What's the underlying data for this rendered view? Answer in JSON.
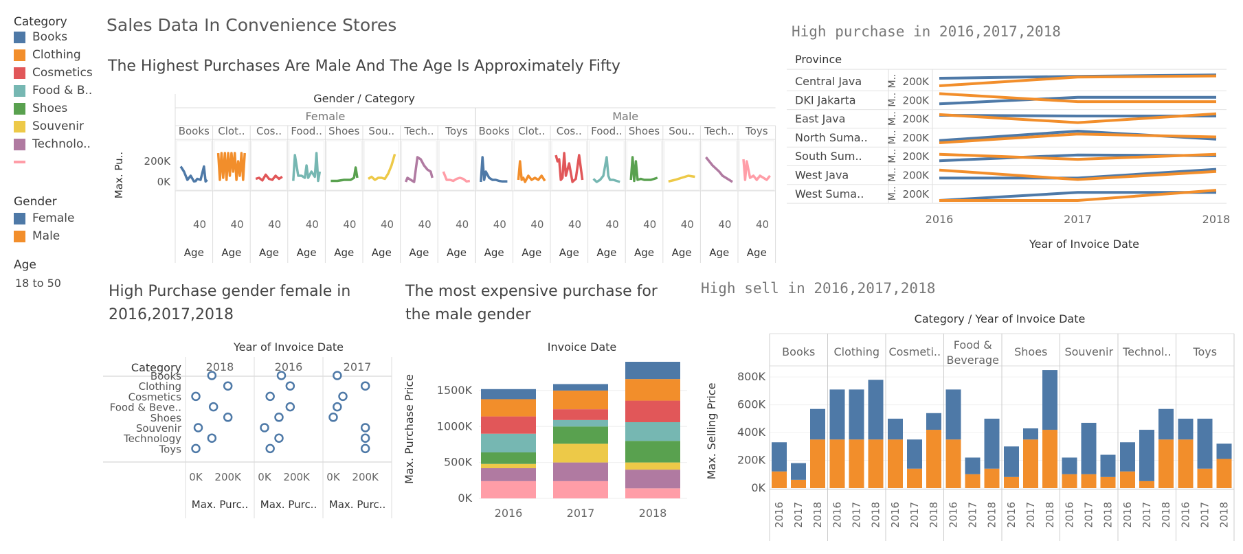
{
  "dashboard": {
    "title": "Sales Data In Convenience Stores",
    "subtitle": "The  Highest Purchases Are Male And The Age Is Approximately Fifty",
    "title_female": "High Purchase gender female in 2016,2017,2018",
    "title_male": "The most expensive purchase for the male gender",
    "title_province": "High purchase in 2016,2017,2018",
    "title_sell": "High sell in 2016,2017,2018"
  },
  "legend": {
    "category_title": "Category",
    "categories": [
      {
        "label": "Books",
        "color": "#4e79a7"
      },
      {
        "label": "Clothing",
        "color": "#f28e2b"
      },
      {
        "label": "Cosmetics",
        "color": "#e15759"
      },
      {
        "label": "Food & B..",
        "color": "#76b7b2"
      },
      {
        "label": "Shoes",
        "color": "#59a14f"
      },
      {
        "label": "Souvenir",
        "color": "#edc948"
      },
      {
        "label": "Technolo..",
        "color": "#b07aa1"
      },
      {
        "label": "",
        "color": "#ff9da7"
      }
    ],
    "gender_title": "Gender",
    "genders": [
      {
        "label": "Female",
        "color": "#4e79a7"
      },
      {
        "label": "Male",
        "color": "#f28e2b"
      }
    ],
    "age_title": "Age",
    "age_value": "18 to 50"
  },
  "chart_data": [
    {
      "id": "age-gender-category",
      "type": "line",
      "title": "Gender / Category",
      "ylabel": "Max. Pu..",
      "xlabel": "Age",
      "x_tick": "40",
      "y_ticks": [
        "200K",
        "0K"
      ],
      "ylim": [
        0,
        300000
      ],
      "genders": [
        "Female",
        "Male"
      ],
      "category_headers": [
        "Books",
        "Clot..",
        "Cos..",
        "Food..",
        "Shoes",
        "Sou..",
        "Tech..",
        "Toys"
      ],
      "category_colors": [
        "#4e79a7",
        "#f28e2b",
        "#e15759",
        "#76b7b2",
        "#59a14f",
        "#edc948",
        "#b07aa1",
        "#ff9da7"
      ],
      "series": [
        {
          "gender": "Female",
          "category": "Books",
          "x": [
            18,
            22,
            26,
            30,
            34,
            36,
            38,
            42,
            46,
            48,
            50
          ],
          "values": [
            150000,
            100000,
            20000,
            60000,
            5000,
            8000,
            30000,
            20000,
            150000,
            5000,
            20000
          ]
        },
        {
          "gender": "Female",
          "category": "Clothing",
          "x": [
            18,
            20,
            22,
            24,
            26,
            28,
            30,
            32,
            34,
            36,
            38,
            40,
            42,
            44,
            46,
            48,
            50
          ],
          "values": [
            280000,
            20000,
            280000,
            40000,
            280000,
            20000,
            280000,
            60000,
            280000,
            100000,
            280000,
            20000,
            200000,
            60000,
            280000,
            20000,
            280000
          ]
        },
        {
          "gender": "Female",
          "category": "Cosmetics",
          "x": [
            18,
            22,
            26,
            30,
            34,
            38,
            42,
            46,
            50
          ],
          "values": [
            30000,
            40000,
            15000,
            70000,
            30000,
            20000,
            60000,
            30000,
            50000
          ]
        },
        {
          "gender": "Female",
          "category": "Food & Beverage",
          "x": [
            18,
            20,
            24,
            28,
            32,
            34,
            36,
            40,
            44,
            46,
            48,
            50
          ],
          "values": [
            10000,
            260000,
            60000,
            60000,
            40000,
            160000,
            40000,
            100000,
            50000,
            280000,
            10000,
            100000
          ]
        },
        {
          "gender": "Female",
          "category": "Shoes",
          "x": [
            18,
            26,
            34,
            42,
            46,
            48,
            50
          ],
          "values": [
            10000,
            10000,
            20000,
            20000,
            40000,
            140000,
            40000
          ]
        },
        {
          "gender": "Female",
          "category": "Souvenir",
          "x": [
            18,
            22,
            26,
            30,
            34,
            38,
            42,
            46,
            50
          ],
          "values": [
            30000,
            50000,
            20000,
            40000,
            40000,
            30000,
            80000,
            160000,
            270000
          ]
        },
        {
          "gender": "Female",
          "category": "Technology",
          "x": [
            18,
            20,
            24,
            28,
            32,
            36,
            40,
            44,
            48,
            50
          ],
          "values": [
            0,
            40000,
            20000,
            0,
            240000,
            220000,
            160000,
            120000,
            100000,
            40000
          ]
        },
        {
          "gender": "Female",
          "category": "Toys",
          "x": [
            18,
            22,
            26,
            30,
            34,
            38,
            42,
            46,
            50
          ],
          "values": [
            100000,
            20000,
            20000,
            10000,
            30000,
            40000,
            30000,
            5000,
            10000
          ]
        },
        {
          "gender": "Male",
          "category": "Books",
          "x": [
            18,
            20,
            22,
            24,
            28,
            32,
            36,
            40,
            44,
            48,
            50
          ],
          "values": [
            0,
            240000,
            20000,
            100000,
            40000,
            20000,
            20000,
            10000,
            5000,
            5000,
            5000
          ]
        },
        {
          "gender": "Male",
          "category": "Clothing",
          "x": [
            18,
            20,
            22,
            24,
            26,
            30,
            34,
            38,
            42,
            46,
            50
          ],
          "values": [
            20000,
            200000,
            20000,
            40000,
            0,
            60000,
            20000,
            40000,
            20000,
            60000,
            10000
          ]
        },
        {
          "gender": "Male",
          "category": "Cosmetics",
          "x": [
            18,
            20,
            22,
            24,
            26,
            28,
            30,
            34,
            38,
            42,
            46,
            50
          ],
          "values": [
            260000,
            200000,
            220000,
            20000,
            40000,
            280000,
            60000,
            180000,
            0,
            30000,
            260000,
            20000
          ]
        },
        {
          "gender": "Male",
          "category": "Food & Beverage",
          "x": [
            18,
            22,
            26,
            30,
            32,
            34,
            36,
            38,
            42,
            46,
            50
          ],
          "values": [
            30000,
            0,
            20000,
            60000,
            150000,
            240000,
            60000,
            20000,
            20000,
            10000,
            0
          ]
        },
        {
          "gender": "Male",
          "category": "Shoes",
          "x": [
            18,
            20,
            22,
            24,
            26,
            30,
            34,
            38,
            42,
            46,
            50
          ],
          "values": [
            20000,
            240000,
            10000,
            200000,
            20000,
            30000,
            20000,
            20000,
            20000,
            30000,
            40000
          ]
        },
        {
          "gender": "Male",
          "category": "Souvenir",
          "x": [
            18,
            26,
            34,
            42,
            50
          ],
          "values": [
            5000,
            20000,
            40000,
            60000,
            50000
          ]
        },
        {
          "gender": "Male",
          "category": "Technology",
          "x": [
            18,
            22,
            26,
            30,
            34,
            38,
            42,
            46,
            50
          ],
          "values": [
            240000,
            200000,
            160000,
            130000,
            100000,
            60000,
            40000,
            20000,
            0
          ]
        },
        {
          "gender": "Male",
          "category": "Toys",
          "x": [
            18,
            20,
            22,
            26,
            30,
            34,
            38,
            42,
            46,
            50
          ],
          "values": [
            220000,
            20000,
            200000,
            40000,
            60000,
            20000,
            60000,
            40000,
            20000,
            60000
          ]
        }
      ]
    },
    {
      "id": "province-yearly",
      "type": "line",
      "title": "High purchase in 2016,2017,2018",
      "row_header": "Province",
      "provinces": [
        "Central Java",
        "DKI Jakarta",
        "East Java",
        "North Suma..",
        "South Sum..",
        "West Java",
        "West Suma.."
      ],
      "measure_label": "M..",
      "y_tick": "200K",
      "x": [
        "2016",
        "2017",
        "2018"
      ],
      "xlabel": "Year of Invoice Date",
      "series": [
        {
          "province": "Central Java",
          "gender": "Female",
          "values": [
            0.72,
            0.85,
            0.95
          ]
        },
        {
          "province": "Central Java",
          "gender": "Male",
          "values": [
            0.2,
            0.8,
            0.88
          ]
        },
        {
          "province": "DKI Jakarta",
          "gender": "Female",
          "values": [
            0.25,
            0.7,
            0.7
          ]
        },
        {
          "province": "DKI Jakarta",
          "gender": "Male",
          "values": [
            0.95,
            0.4,
            0.4
          ]
        },
        {
          "province": "East Java",
          "gender": "Female",
          "values": [
            0.75,
            0.7,
            0.7
          ]
        },
        {
          "province": "East Java",
          "gender": "Male",
          "values": [
            0.8,
            0.25,
            0.85
          ]
        },
        {
          "province": "North Suma..",
          "gender": "Female",
          "values": [
            0.3,
            0.95,
            0.4
          ]
        },
        {
          "province": "North Suma..",
          "gender": "Male",
          "values": [
            0.15,
            0.75,
            0.55
          ]
        },
        {
          "province": "South Sum..",
          "gender": "Female",
          "values": [
            0.2,
            0.6,
            0.55
          ]
        },
        {
          "province": "South Sum..",
          "gender": "Male",
          "values": [
            0.65,
            0.3,
            0.65
          ]
        },
        {
          "province": "West Java",
          "gender": "Female",
          "values": [
            0.3,
            0.3,
            0.9
          ]
        },
        {
          "province": "West Java",
          "gender": "Male",
          "values": [
            0.85,
            0.2,
            0.75
          ]
        },
        {
          "province": "West Suma..",
          "gender": "Female",
          "values": [
            0.05,
            0.6,
            0.6
          ]
        },
        {
          "province": "West Suma..",
          "gender": "Male",
          "values": [
            0.05,
            0.05,
            0.75
          ]
        }
      ]
    },
    {
      "id": "female-dotplot",
      "type": "scatter",
      "title": "High Purchase gender female in 2016,2017,2018",
      "column_header": "Year of Invoice Date",
      "row_header": "Category",
      "years": [
        "2018",
        "2016",
        "2017"
      ],
      "categories": [
        "Books",
        "Clothing",
        "Cosmetics",
        "Food & Beve..",
        "Shoes",
        "Souvenir",
        "Technology",
        "Toys"
      ],
      "x_ticks": [
        "0K",
        "200K"
      ],
      "xlabel": "Max. Purc..",
      "values": {
        "2018": [
          100000,
          200000,
          0,
          110000,
          200000,
          15000,
          100000,
          0
        ],
        "2016": [
          105000,
          160000,
          35000,
          160000,
          90000,
          0,
          90000,
          35000
        ],
        "2017": [
          25000,
          200000,
          60000,
          25000,
          0,
          200000,
          200000,
          200000
        ]
      }
    },
    {
      "id": "male-stacked",
      "type": "bar",
      "title": "Invoice Date",
      "ylabel": "Max. Purchase Price",
      "categories": [
        "2016",
        "2017",
        "2018"
      ],
      "y_ticks": [
        "1500K",
        "1000K",
        "500K",
        "0K"
      ],
      "ylim": [
        0,
        1900000
      ],
      "series": [
        {
          "name": "Toys",
          "values": [
            240000,
            240000,
            140000
          ]
        },
        {
          "name": "Technology",
          "values": [
            180000,
            260000,
            260000
          ]
        },
        {
          "name": "Souvenir",
          "values": [
            60000,
            260000,
            100000
          ]
        },
        {
          "name": "Shoes",
          "values": [
            160000,
            240000,
            300000
          ]
        },
        {
          "name": "Food & Beverage",
          "values": [
            260000,
            90000,
            260000
          ]
        },
        {
          "name": "Cosmetics",
          "values": [
            240000,
            150000,
            300000
          ]
        },
        {
          "name": "Clothing",
          "values": [
            240000,
            260000,
            300000
          ]
        },
        {
          "name": "Books",
          "values": [
            140000,
            90000,
            240000
          ]
        }
      ]
    },
    {
      "id": "selling-price",
      "type": "bar",
      "title": "Category / Year of Invoice Date",
      "ylabel": "Max. Selling Price",
      "category_headers": [
        "Books",
        "Clothing",
        "Cosmeti..",
        "Food & Beverage",
        "Shoes",
        "Souvenir",
        "Technol..",
        "Toys"
      ],
      "years": [
        "2016",
        "2017",
        "2018"
      ],
      "y_ticks": [
        "800K",
        "600K",
        "400K",
        "200K",
        "0K"
      ],
      "ylim": [
        0,
        880000
      ],
      "series": [
        {
          "name": "Male",
          "values": [
            120000,
            60000,
            350000,
            350000,
            350000,
            350000,
            350000,
            140000,
            420000,
            350000,
            100000,
            140000,
            80000,
            350000,
            420000,
            100000,
            100000,
            80000,
            120000,
            50000,
            350000,
            350000,
            140000,
            210000
          ]
        },
        {
          "name": "Female",
          "values": [
            210000,
            120000,
            220000,
            360000,
            360000,
            430000,
            150000,
            210000,
            120000,
            360000,
            120000,
            360000,
            220000,
            80000,
            430000,
            120000,
            370000,
            160000,
            210000,
            370000,
            220000,
            150000,
            360000,
            110000
          ]
        }
      ]
    }
  ]
}
